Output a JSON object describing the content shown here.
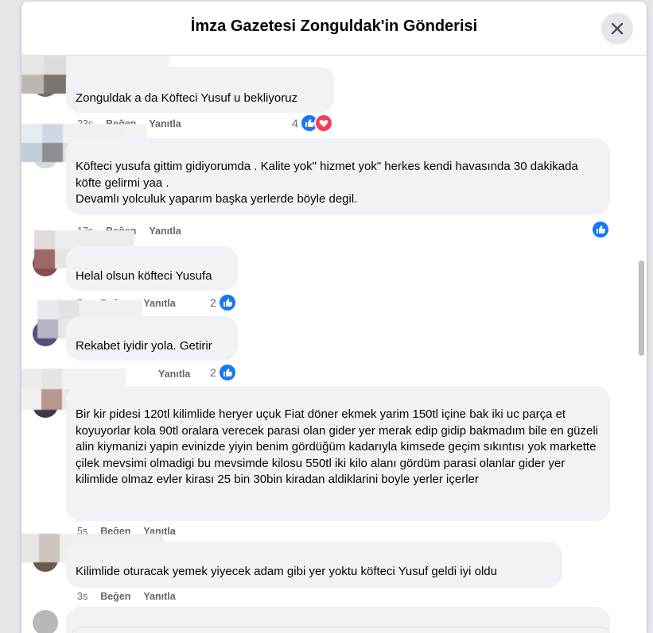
{
  "dialog": {
    "title": "İmza Gazetesi Zonguldak'in Gönderisi"
  },
  "actions": {
    "like": "Beğen",
    "reply": "Yanıtla"
  },
  "colors": {
    "like": "#1877f2",
    "love": "#f33e58",
    "bubble": "#f0f2f5",
    "meta": "#65676b"
  },
  "comments": [
    {
      "text": "Zonguldak a da Köfteci Yusuf u bekliyoruz",
      "time": "23s",
      "reactions": "4"
    },
    {
      "text": "Köfteci yusufa gittim gidiyorumda . Kalite yok\" hizmet yok\" herkes kendi havasında 30 dakikada köfte gelirmi yaa .\nDevamlı yolculuk yaparım başka yerlerde böyle degil.",
      "time": "17s"
    },
    {
      "text": "Helal olsun köfteci Yusufa",
      "time": "7s",
      "reactions": "2"
    },
    {
      "text": "Rekabet iyidir yola. Getirir",
      "reactions": "2"
    },
    {
      "text": "Bir kir pidesi 120tl kilimlide heryer uçuk Fiat döner ekmek yarim 150tl içine bak iki uc parça et koyuyorlar kola 90tl oralara verecek parasi olan gider yer merak edip gidip bakmadım bile en güzeli alin kiymanizi yapin evinizde yiyin benim gördüğüm kadarıyla kimsede geçim sıkıntısı yok markette çilek mevsimi olmadigi bu mevsimde kilosu 550tl iki kilo alanı gördüm parasi olanlar gider yer kilimlide olmaz evler kirası 25 bin 30bin kiradan aldiklarini boyle yerler içerler",
      "time": "5s"
    },
    {
      "text": "Kilimlide oturacak yemek yiyecek adam gibi yer yoktu köfteci Yusuf geldi iyi oldu",
      "time": "3s"
    }
  ]
}
